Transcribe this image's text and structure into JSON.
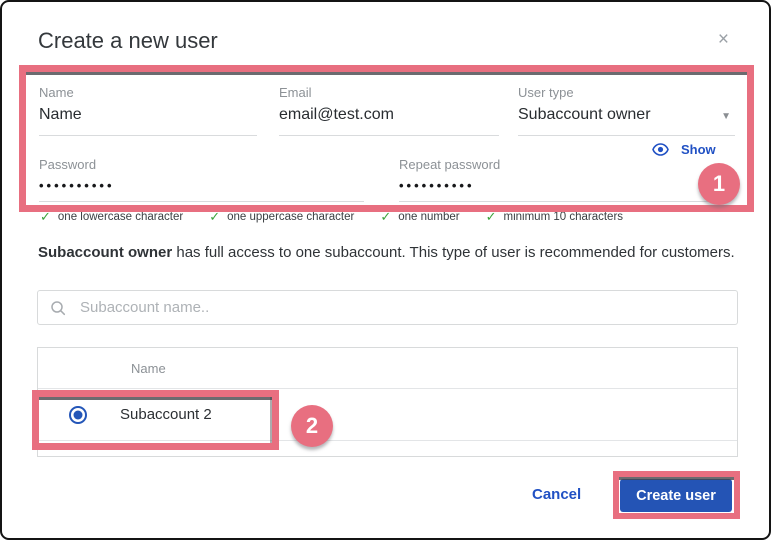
{
  "modal": {
    "title": "Create a new user",
    "close_icon": "×"
  },
  "form": {
    "name_label": "Name",
    "name_value": "Name",
    "email_label": "Email",
    "email_value": "email@test.com",
    "user_type_label": "User type",
    "user_type_value": "Subaccount owner",
    "password_label": "Password",
    "password_value": "••••••••••",
    "repeat_password_label": "Repeat password",
    "repeat_password_value": "••••••••••",
    "show_label": "Show",
    "dropdown_caret": "▼"
  },
  "password_rules": [
    "one lowercase character",
    "one uppercase character",
    "one number",
    "minimum 10 characters"
  ],
  "check_glyph": "✓",
  "description": {
    "bold": "Subaccount owner",
    "rest": " has full access to one subaccount. This type of user is recommended for customers."
  },
  "search": {
    "placeholder": "Subaccount name.."
  },
  "table": {
    "name_header": "Name",
    "rows": [
      {
        "name": "Subaccount 2",
        "selected": true
      }
    ]
  },
  "footer": {
    "cancel": "Cancel",
    "create": "Create user"
  },
  "annotations": {
    "step1": "1",
    "step2": "2"
  },
  "colors": {
    "annotation_pink": "#E86F80",
    "link_blue": "#2151C4",
    "button_blue": "#2454B5",
    "radio_blue": "#2456B8",
    "success_green": "#3DA43D"
  }
}
